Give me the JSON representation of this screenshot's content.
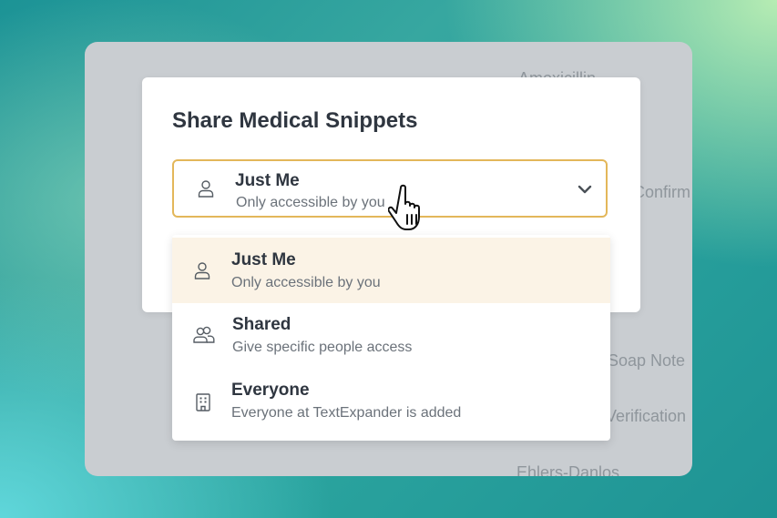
{
  "background": {
    "items": [
      "Amoxicillin",
      "Confirm",
      "Soap Note",
      "Verification",
      "Ehlers-Danlos"
    ]
  },
  "modal": {
    "title": "Share Medical Snippets",
    "selected": {
      "label": "Just Me",
      "description": "Only accessible by you",
      "icon": "person-icon"
    }
  },
  "dropdown": {
    "options": [
      {
        "label": "Just Me",
        "description": "Only accessible by you",
        "icon": "person-icon",
        "highlighted": true
      },
      {
        "label": "Shared",
        "description": "Give specific people access",
        "icon": "people-icon",
        "highlighted": false
      },
      {
        "label": "Everyone",
        "description": "Everyone at TextExpander is added",
        "icon": "building-icon",
        "highlighted": false
      }
    ]
  },
  "colors": {
    "accent_border": "#e3b75a",
    "highlight_bg": "#fbf3e6",
    "title_text": "#2f3640"
  }
}
